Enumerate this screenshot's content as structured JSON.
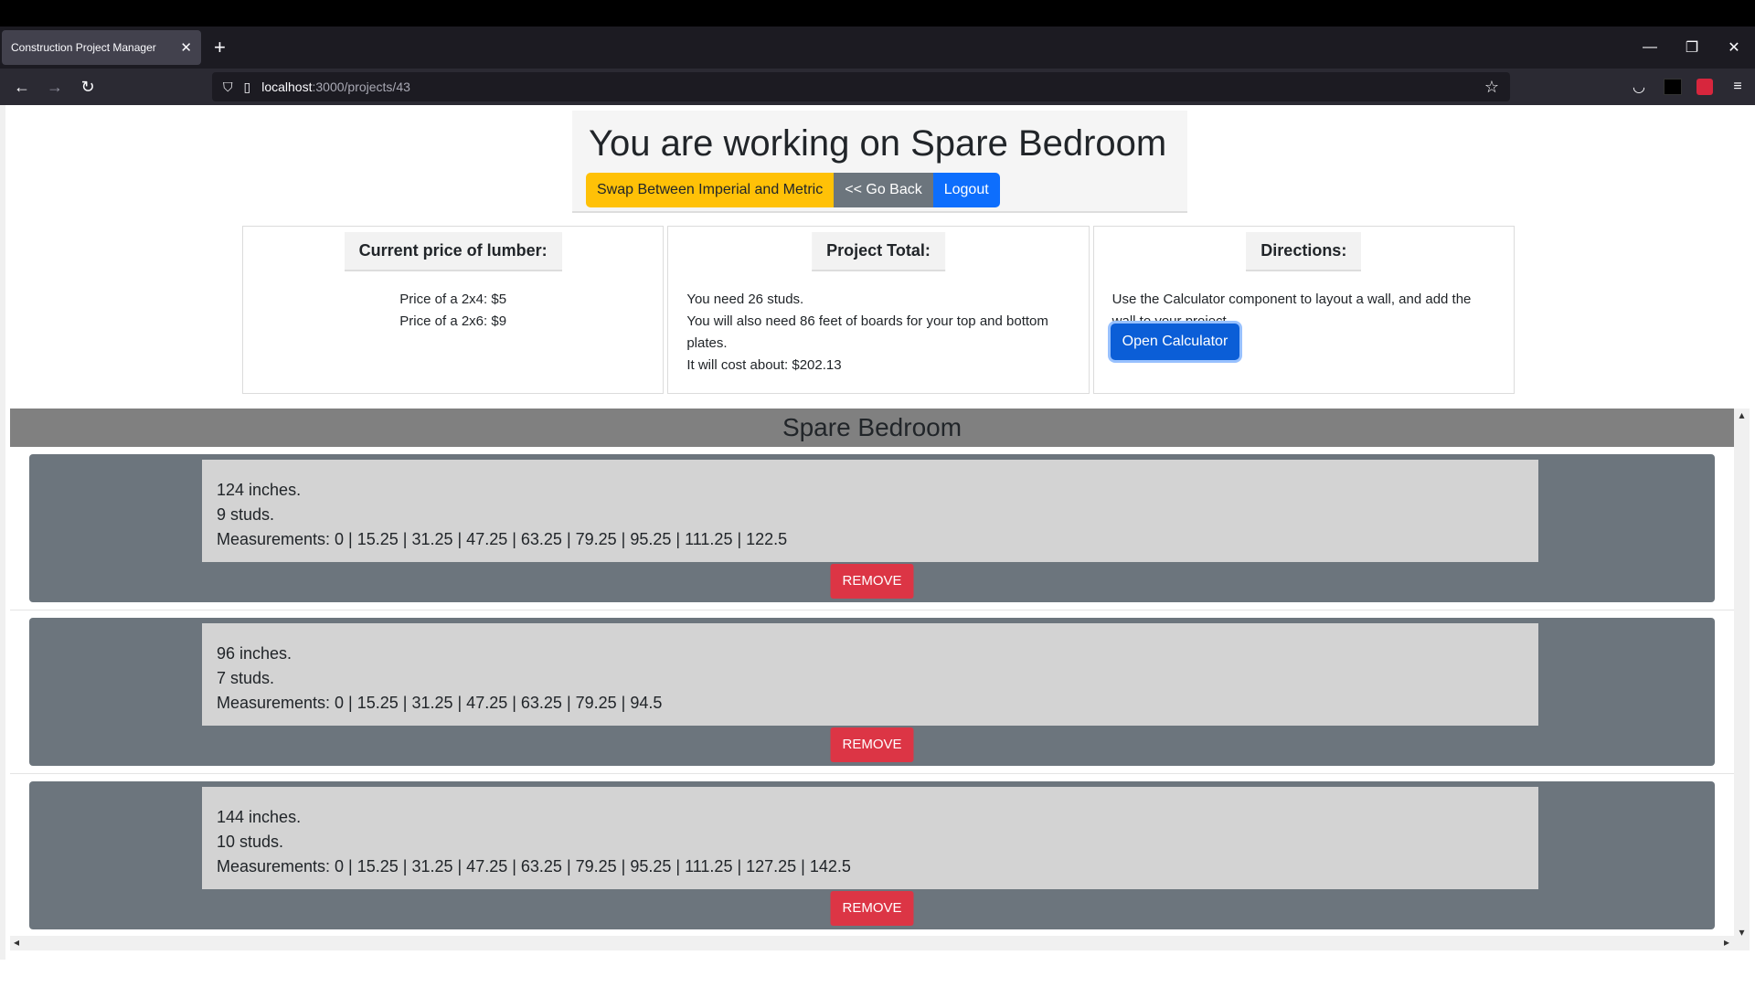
{
  "browser": {
    "tab_title": "Construction Project Manager",
    "url_host": "localhost",
    "url_path": ":3000/projects/43"
  },
  "header": {
    "title": "You are working on  Spare Bedroom",
    "swap_label": "Swap Between Imperial and Metric",
    "back_label": "<< Go Back",
    "logout_label": "Logout"
  },
  "lumber": {
    "heading": "Current price of lumber:",
    "price_2x4": "Price of a 2x4: $5",
    "price_2x6": "Price of a 2x6: $9"
  },
  "total": {
    "heading": "Project Total:",
    "studs": "You need  26  studs.",
    "boards": "You will also need  86 feet of boards for your top and bottom plates.",
    "cost": "It will cost about: $202.13"
  },
  "directions": {
    "heading": "Directions:",
    "text": "Use the Calculator component to layout a wall, and add the wall to your project.",
    "button_label": "Open Calculator"
  },
  "project_name": "Spare Bedroom",
  "walls": [
    {
      "length": "124  inches.",
      "studs": "9  studs.",
      "measurements": "Measurements:  0 | 15.25 | 31.25 | 47.25 | 63.25 | 79.25 | 95.25 | 111.25 | 122.5",
      "remove_label": "REMOVE"
    },
    {
      "length": "96  inches.",
      "studs": "7  studs.",
      "measurements": "Measurements:  0 | 15.25 | 31.25 | 47.25 | 63.25 | 79.25 | 94.5",
      "remove_label": "REMOVE"
    },
    {
      "length": "144  inches.",
      "studs": "10  studs.",
      "measurements": "Measurements:  0 | 15.25 | 31.25 | 47.25 | 63.25 | 79.25 | 95.25 | 111.25 | 127.25 | 142.5",
      "remove_label": "REMOVE"
    }
  ]
}
